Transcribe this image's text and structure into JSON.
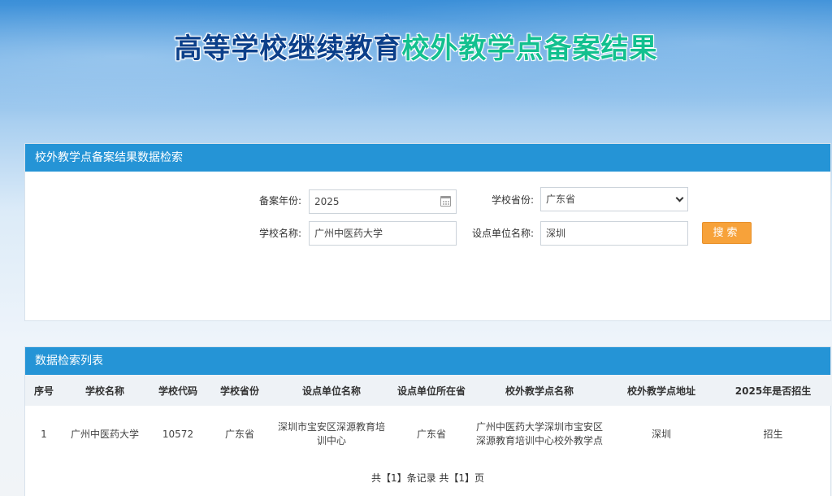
{
  "title": {
    "part1": "高等学校继续教育",
    "part2": "校外教学点备案结果"
  },
  "search_panel": {
    "header": "校外教学点备案结果数据检索",
    "year_label": "备案年份:",
    "year_value": "2025",
    "province_label": "学校省份:",
    "province_value": "广东省",
    "school_label": "学校名称:",
    "school_value": "广州中医药大学",
    "unit_label": "设点单位名称:",
    "unit_value": "深圳",
    "search_button": "搜索"
  },
  "result_panel": {
    "header": "数据检索列表",
    "columns": [
      "序号",
      "学校名称",
      "学校代码",
      "学校省份",
      "设点单位名称",
      "设点单位所在省",
      "校外教学点名称",
      "校外教学点地址",
      "2025年是否招生"
    ],
    "rows": [
      [
        "1",
        "广州中医药大学",
        "10572",
        "广东省",
        "深圳市宝安区深源教育培训中心",
        "广东省",
        "广州中医药大学深圳市宝安区深源教育培训中心校外教学点",
        "深圳",
        "招生"
      ]
    ],
    "pagination": "共【1】条记录 共【1】页"
  },
  "icons": {
    "year_input": "calendar-icon",
    "province_select": "chevron-down-icon"
  },
  "colors": {
    "header_bar": "#2594d6",
    "search_button": "#f7a23a",
    "title_primary": "#0b3f8a",
    "title_accent": "#13c08f"
  }
}
